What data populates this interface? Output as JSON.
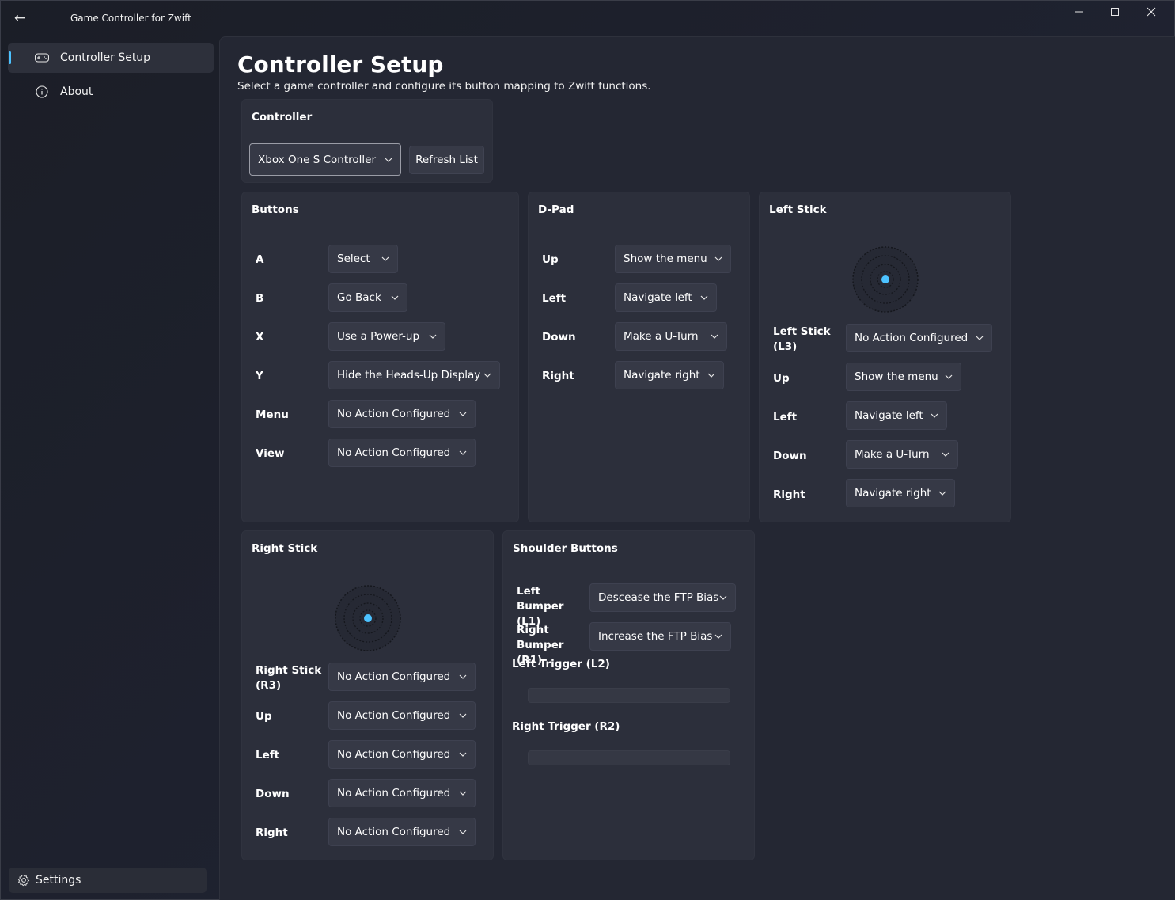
{
  "app": {
    "title": "Game Controller for Zwift"
  },
  "window_controls": {
    "minimize": "—",
    "maximize": "☐",
    "close": "✕"
  },
  "nav": {
    "back": "←",
    "items": [
      {
        "label": "Controller Setup",
        "icon": "gamepad-icon",
        "active": true
      },
      {
        "label": "About",
        "icon": "info-icon",
        "active": false
      }
    ],
    "settings_label": "Settings"
  },
  "page": {
    "title": "Controller Setup",
    "subtitle": "Select a game controller and configure its button mapping to Zwift functions."
  },
  "controller": {
    "title": "Controller",
    "selected": "Xbox One S Controller",
    "refresh_label": "Refresh List"
  },
  "buttons": {
    "title": "Buttons",
    "rows": [
      {
        "label": "A",
        "action": "Select"
      },
      {
        "label": "B",
        "action": "Go Back"
      },
      {
        "label": "X",
        "action": "Use a Power-up"
      },
      {
        "label": "Y",
        "action": "Hide the Heads-Up Display"
      },
      {
        "label": "Menu",
        "action": "No Action Configured"
      },
      {
        "label": "View",
        "action": "No Action Configured"
      }
    ]
  },
  "dpad": {
    "title": "D-Pad",
    "rows": [
      {
        "label": "Up",
        "action": "Show the menu"
      },
      {
        "label": "Left",
        "action": "Navigate left"
      },
      {
        "label": "Down",
        "action": "Make a U-Turn"
      },
      {
        "label": "Right",
        "action": "Navigate right"
      }
    ]
  },
  "left_stick": {
    "title": "Left Stick",
    "rows": [
      {
        "label": "Left Stick (L3)",
        "action": "No Action Configured"
      },
      {
        "label": "Up",
        "action": "Show the menu"
      },
      {
        "label": "Left",
        "action": "Navigate left"
      },
      {
        "label": "Down",
        "action": "Make a U-Turn"
      },
      {
        "label": "Right",
        "action": "Navigate right"
      }
    ]
  },
  "right_stick": {
    "title": "Right Stick",
    "rows": [
      {
        "label": "Right Stick (R3)",
        "action": "No Action Configured"
      },
      {
        "label": "Up",
        "action": "No Action Configured"
      },
      {
        "label": "Left",
        "action": "No Action Configured"
      },
      {
        "label": "Down",
        "action": "No Action Configured"
      },
      {
        "label": "Right",
        "action": "No Action Configured"
      }
    ]
  },
  "shoulder": {
    "title": "Shoulder Buttons",
    "rows": [
      {
        "label": "Left Bumper (L1)",
        "action": "Descease the FTP Bias"
      },
      {
        "label": "Right Bumper (R1)",
        "action": "Increase the FTP Bias"
      }
    ],
    "left_trigger_label": "Left Trigger (L2)",
    "right_trigger_label": "Right Trigger (R2)",
    "left_trigger_value": 0,
    "right_trigger_value": 0
  },
  "colors": {
    "accent": "#4cc2ff",
    "card": "#2c2f3b",
    "dropdown": "#363946"
  }
}
